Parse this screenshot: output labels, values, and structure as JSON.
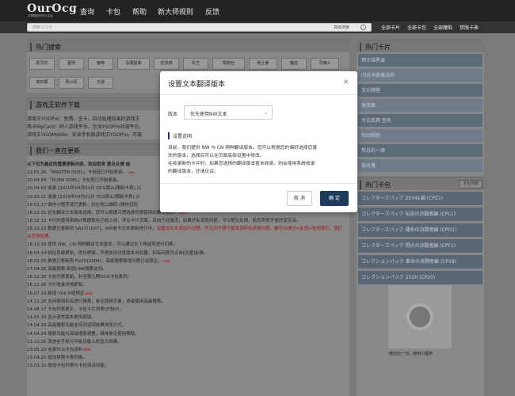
{
  "header": {
    "logo": "OurOcg",
    "logo_sub": "共享精彩的决斗生活",
    "nav": [
      "查询",
      "卡包",
      "帮助",
      "新大师规则",
      "反馈"
    ]
  },
  "search": {
    "placeholder": "搜索入口卡",
    "advanced": "高级搜索",
    "links": [
      "全部卡片",
      "全部卡包",
      "全部魔陷",
      "禁限卡表"
    ]
  },
  "hot_search": {
    "title": "热门搜索",
    "tags": [
      "影灵衣",
      "墓地",
      "魔帝",
      "急襲猛禽",
      "召龙棋",
      "斥王",
      "瑕丽丝",
      "枪士姜",
      "魔虚",
      "灵魂火",
      "真红眼",
      "阴火机",
      "光道"
    ]
  },
  "software": {
    "title": "游戏王软件下载",
    "lines": [
      "游戏王YGOPro：免费、全卡、自动处理效果的游戏王",
      "两卡MyCard：同人游戏平台，包含YGOPro对战平台。",
      "游戏王YGOMobile：安卓手机版游戏王YGOPro，可离"
    ]
  },
  "updates": {
    "title": "我们一直在更新",
    "intro": "以下仅为最近的重要更新内容，欢迎您来 意见反馈 给",
    "items": [
      {
        "date": "22.01.26",
        "text": "「MASTER DUEL」卡包现已开始收录。",
        "red": "",
        "new": "new"
      },
      {
        "date": "20.04.04",
        "text": "「RUSH DUEL」卡包现已开始收录。",
        "red": "",
        "new": ""
      },
      {
        "date": "20.04.03",
        "text": "收录 [2020年04月01日 OCG禁止/限制卡表] 以",
        "red": "",
        "new": ""
      },
      {
        "date": "19.03.21",
        "text": "收录 [2019年04月01日 TCG禁止/限制卡表] 以",
        "red": "",
        "new": ""
      },
      {
        "date": "19.01.17",
        "text": "微信小程序现已更新，扫左侧二维码 (微信扫码",
        "red": "",
        "new": ""
      },
      {
        "date": "18.12.31",
        "text": "优化翻译文本版本选择，您可以根据习惯选择您想使用的翻译版本。",
        "red": "",
        "new": "beta"
      },
      {
        "date": "18.12.13",
        "text": "卡片的使用率统计数据现在已经上线，详见卡片页面，目前已经激活，如果还有发现问题，可以提交反馈，给您带来不便还望见谅。",
        "red": "",
        "new": ""
      },
      {
        "date": "18.10.22",
        "text": "数据已更新到 SAST(1007)，NW老卡文本更新进行中，",
        "red": "双重译文本试运行过程，不论对于哪个版本资料有发现问题，都可以通过<反馈>告知我们，我们会尽快处理。",
        "new": ""
      },
      {
        "date": "18.10.19",
        "text": "提供 NW、CN 两种翻译文本版本，可以通过右下角选项进行切换。",
        "red": "",
        "new": ""
      },
      {
        "date": "18.03.14",
        "text": "网站系统更新，优化界面，不再支持过低版本浏览器，如有问题可点击[还重]反馈。",
        "red": "",
        "new": ""
      },
      {
        "date": "18.02.05",
        "text": "数据已更新到 FLOD(1004)，高级搜索新增问题已经修正。",
        "red": "",
        "new": "new"
      },
      {
        "date": "17.04.25",
        "text": "高级搜索 新增LINK搜索支持。",
        "red": "",
        "new": ""
      },
      {
        "date": "16.12.30",
        "text": "卡包列表更新，补全第九期OCG卡包系列。",
        "red": "",
        "new": ""
      },
      {
        "date": "16.12.26",
        "text": "卡片收录详情更新。",
        "red": "",
        "new": ""
      },
      {
        "date": "16.07.14",
        "text": "新增 YDK卡组预览",
        "red": "",
        "new": "beta"
      },
      {
        "date": "14.11.28",
        "text": "支持使用別名进行搜索，参见使用手册，或者使用高级搜索。",
        "red": "",
        "new": ""
      },
      {
        "date": "14.08.17",
        "text": "卡包列表更正，卡包卡片列表OT标分。",
        "red": "",
        "new": ""
      },
      {
        "date": "14.05.18",
        "text": "显示语言版本更改按钮。",
        "red": "",
        "new": ""
      },
      {
        "date": "14.04.29",
        "text": "高级搜索功能支持对返回结果排序方式。",
        "red": "",
        "new": ""
      },
      {
        "date": "14.04.24",
        "text": "搜索功能与高级搜索调整，具体参见使用帮助。",
        "red": "",
        "new": ""
      },
      {
        "date": "13.11.25",
        "text": "改进在手机与平板设备上的显示效果。",
        "red": "",
        "new": ""
      },
      {
        "date": "13.05.12",
        "text": "收录TCG卡包资料",
        "red": "",
        "new": "80%"
      },
      {
        "date": "13.04.25",
        "text": "增加禁限卡表列表。",
        "red": "",
        "new": ""
      },
      {
        "date": "13.03.15",
        "text": "增加卡包列表与卡包测试功能。",
        "red": "",
        "new": ""
      }
    ]
  },
  "hot_cards": {
    "title": "热门卡片",
    "items": [
      "冥王结界波",
      "闪光卡家魔法师",
      "次元障壁",
      "激流葬",
      "大古武具·圣枪",
      "别动规则",
      "禁忌的一滴",
      "倍光鬼"
    ]
  },
  "hot_packs": {
    "title": "热门卡包",
    "more": "卡包列表",
    "items": [
      "コレクターズパック ZEXAL編 (CPZ1)",
      "コレクターズパック 伝説の決闘者編 (CPL1)",
      "コレクターズパック 運命の決闘者編 (CPD1)",
      "コレクターズパック 閃光の決闘者編 (CPF1)",
      "コレクションパック 革命の決闘者編 (CP19)",
      "コレクションパック 2020 (CP20)"
    ]
  },
  "qr_caption": "微信扫一扫，使用小程序",
  "modal": {
    "title": "设置文本翻译版本",
    "close": "×",
    "version_label": "版本",
    "version_value": "优先使用NW文本",
    "note_title": "设置说明",
    "note_lines": [
      "目前，我们提供 NW 与 CN 两种翻译版本。您可以根据您的偏好选择您喜",
      "欢的版本，选择后可以在页面底部设置中修改。",
      "在收录新的卡片时，如果您选择的翻译版本暂未收录，则会使用系统收录",
      "的翻译版本，还请见谅。"
    ],
    "cancel": "取 消",
    "ok": "确 定"
  }
}
